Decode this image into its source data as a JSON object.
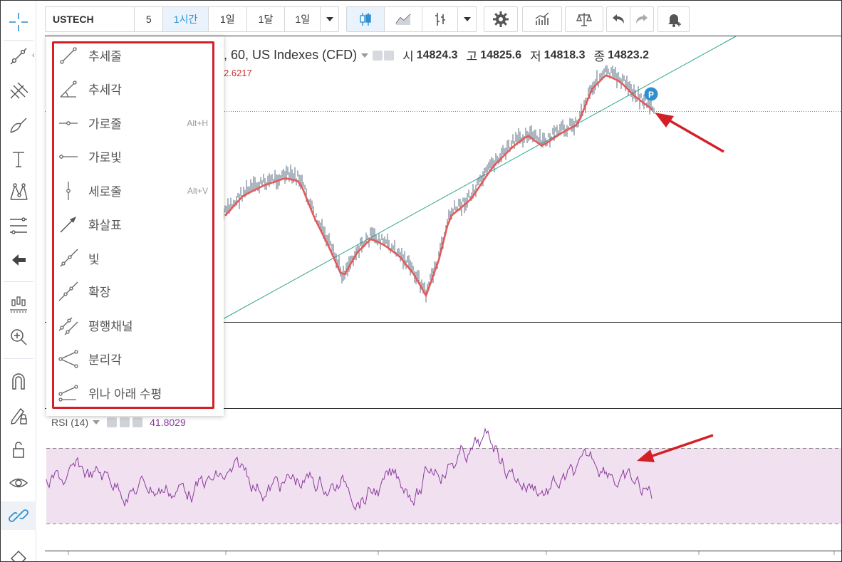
{
  "top_toolbar": {
    "symbol": "USTECH",
    "intervals": [
      "5",
      "1시간",
      "1일",
      "1달",
      "1일"
    ],
    "active_interval": "1시간",
    "icons": [
      "candles-icon",
      "area-chart-icon",
      "bars-icon",
      "settings-icon",
      "indicators-icon",
      "compare-icon",
      "undo-icon",
      "redo-icon",
      "alert-add-icon"
    ]
  },
  "left_toolbar": {
    "collapse_glyph": "‹",
    "icons": [
      "crosshair-icon",
      "trendline-icon",
      "pitchfork-icon",
      "brush-icon",
      "text-icon",
      "pattern-icon",
      "fib-icon",
      "arrow-left-icon",
      "prediction-icon",
      "zoom-in-icon",
      "magnet-icon",
      "lock-pencil-icon",
      "lock-open-icon",
      "eye-icon",
      "link-icon",
      "eraser-icon"
    ]
  },
  "legend": {
    "title": ", 60, US Indexes (CFD)",
    "open_label": "시",
    "open": "14824.3",
    "high_label": "고",
    "high": "14825.6",
    "low_label": "저",
    "low": "14818.3",
    "close_label": "종",
    "close": "14823.2",
    "ma_value": "2.6217"
  },
  "rsi": {
    "label": "RSI (14)",
    "value": "41.8029"
  },
  "dropdown": {
    "items": [
      {
        "label": "추세줄",
        "shortcut": ""
      },
      {
        "label": "추세각",
        "shortcut": ""
      },
      {
        "label": "가로줄",
        "shortcut": "Alt+H"
      },
      {
        "label": "가로빛",
        "shortcut": ""
      },
      {
        "label": "세로줄",
        "shortcut": "Alt+V"
      },
      {
        "label": "화살표",
        "shortcut": ""
      },
      {
        "label": "빛",
        "shortcut": ""
      },
      {
        "label": "확장",
        "shortcut": ""
      },
      {
        "label": "평행채널",
        "shortcut": ""
      },
      {
        "label": "분리각",
        "shortcut": ""
      },
      {
        "label": "위나 아래 수평",
        "shortcut": ""
      }
    ]
  },
  "annotations": {
    "dropdown_box_color": "#d32028",
    "arrow_color": "#d32028",
    "position_marker": "P"
  },
  "colors": {
    "ma_line": "#e35a5a",
    "price_bars": "#5a6c80",
    "trendline": "#2fa58f",
    "rsi_line": "#8b3a9e",
    "rsi_band": "#f1e1f0",
    "accent": "#2f8fd1"
  }
}
